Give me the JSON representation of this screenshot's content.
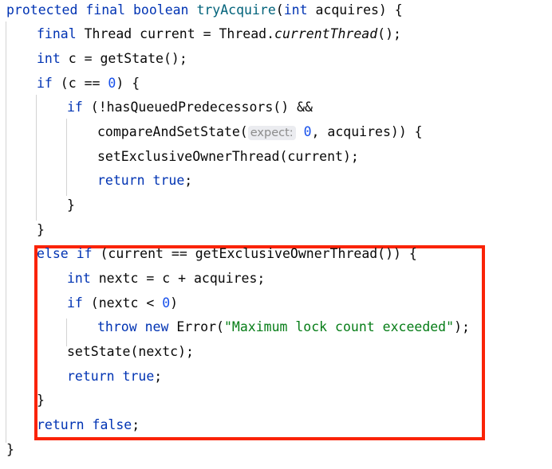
{
  "editor": {
    "language": "java",
    "background_color": "#ffffff",
    "font_size_px": 16.5,
    "line_height_px": 30.5,
    "colors": {
      "keyword": "#0033b3",
      "number": "#1750eb",
      "string": "#067d17",
      "method_declaration": "#00627a",
      "plain_text": "#080808",
      "indent_guide": "#d3d3d3",
      "parameter_hint_text": "#8c8c8c",
      "parameter_hint_background": "#ebecf0",
      "annotation_box": "#fa2306"
    },
    "annotation": {
      "type": "rectangle-highlight",
      "color": "#fa2306",
      "covers_lines": [
        11,
        12,
        13,
        14,
        15,
        16,
        17,
        18
      ]
    },
    "lines": [
      {
        "n": 1,
        "indent": 0,
        "text": "protected final boolean tryAcquire(int acquires) {"
      },
      {
        "n": 2,
        "indent": 1,
        "text": "final Thread current = Thread.currentThread();"
      },
      {
        "n": 3,
        "indent": 1,
        "text": "int c = getState();"
      },
      {
        "n": 4,
        "indent": 1,
        "text": "if (c == 0) {"
      },
      {
        "n": 5,
        "indent": 2,
        "text": "if (!hasQueuedPredecessors() &&"
      },
      {
        "n": 6,
        "indent": 3,
        "text": "compareAndSetState( expect: 0, acquires)) {"
      },
      {
        "n": 7,
        "indent": 3,
        "text": "setExclusiveOwnerThread(current);"
      },
      {
        "n": 8,
        "indent": 3,
        "text": "return true;"
      },
      {
        "n": 9,
        "indent": 2,
        "text": "}"
      },
      {
        "n": 10,
        "indent": 1,
        "text": "}"
      },
      {
        "n": 11,
        "indent": 1,
        "text": "else if (current == getExclusiveOwnerThread()) {"
      },
      {
        "n": 12,
        "indent": 2,
        "text": "int nextc = c + acquires;"
      },
      {
        "n": 13,
        "indent": 2,
        "text": "if (nextc < 0)"
      },
      {
        "n": 14,
        "indent": 3,
        "text": "throw new Error(\"Maximum lock count exceeded\");"
      },
      {
        "n": 15,
        "indent": 2,
        "text": "setState(nextc);"
      },
      {
        "n": 16,
        "indent": 2,
        "text": "return true;"
      },
      {
        "n": 17,
        "indent": 1,
        "text": "}"
      },
      {
        "n": 18,
        "indent": 1,
        "text": "return false;"
      },
      {
        "n": 19,
        "indent": 0,
        "text": "}"
      }
    ],
    "parameter_hints": [
      {
        "line": 6,
        "label": "expect:",
        "value": "0"
      }
    ],
    "strings": [
      {
        "line": 14,
        "value": "\"Maximum lock count exceeded\""
      }
    ],
    "method_names": [
      "tryAcquire",
      "currentThread",
      "getState",
      "hasQueuedPredecessors",
      "compareAndSetState",
      "setExclusiveOwnerThread",
      "getExclusiveOwnerThread",
      "setState"
    ],
    "keywords_used": [
      "protected",
      "final",
      "boolean",
      "int",
      "if",
      "else",
      "return",
      "true",
      "false",
      "throw",
      "new"
    ]
  }
}
